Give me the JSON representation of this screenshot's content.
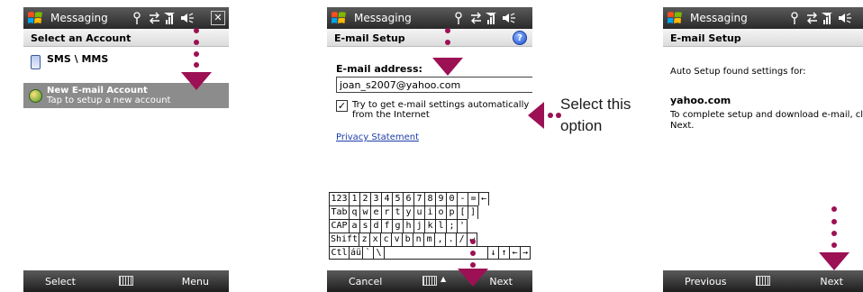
{
  "accent_color": "#9c1054",
  "screens": [
    {
      "title_bar": {
        "app_name": "Messaging",
        "icons": [
          "windows-logo",
          "antenna-icon",
          "data-sync-icon",
          "signal-bars-icon",
          "speaker-icon",
          "close-icon"
        ],
        "close_label": "✕"
      },
      "header": "Select an Account",
      "accounts": [
        {
          "name": "SMS \\ MMS",
          "icon": "sms-icon"
        },
        {
          "name": "New E-mail Account",
          "subtitle": "Tap to setup a new account",
          "icon": "globe-icon",
          "selected": true
        }
      ],
      "softkeys": {
        "left": "Select",
        "right": "Menu"
      }
    },
    {
      "title_bar": {
        "app_name": "Messaging",
        "icons": [
          "windows-logo",
          "antenna-icon",
          "data-sync-icon",
          "signal-bars-icon",
          "speaker-icon"
        ]
      },
      "header": "E-mail Setup",
      "help_label": "?",
      "form": {
        "email_label": "E-mail address:",
        "email_value": "joan_s2007@yahoo.com",
        "auto_settings_label": "Try to get e-mail settings automatically from the Internet",
        "auto_settings_checked": true,
        "checkmark": "✓",
        "privacy_link": "Privacy Statement"
      },
      "keyboard_rows": [
        [
          "123",
          "1",
          "2",
          "3",
          "4",
          "5",
          "6",
          "7",
          "8",
          "9",
          "0",
          "-",
          "=",
          "←"
        ],
        [
          "Tab",
          "q",
          "w",
          "e",
          "r",
          "t",
          "y",
          "u",
          "i",
          "o",
          "p",
          "[",
          "]"
        ],
        [
          "CAP",
          "a",
          "s",
          "d",
          "f",
          "g",
          "h",
          "j",
          "k",
          "l",
          ";",
          "'"
        ],
        [
          "Shift",
          "z",
          "x",
          "c",
          "v",
          "b",
          "n",
          "m",
          ",",
          ".",
          "/",
          "↵"
        ],
        [
          "Ctl",
          "áü",
          "`",
          "\\",
          " ",
          "↓",
          "↑",
          "←",
          "→"
        ]
      ],
      "softkeys": {
        "left": "Cancel",
        "right": "Next"
      }
    },
    {
      "title_bar": {
        "app_name": "Messaging",
        "icons": [
          "windows-logo",
          "antenna-icon",
          "data-sync-icon",
          "signal-bars-icon",
          "speaker-icon"
        ]
      },
      "header": "E-mail Setup",
      "body": {
        "found_text": "Auto Setup found settings for:",
        "domain": "yahoo.com",
        "instruction_line1": "To complete setup and download e-mail, click",
        "instruction_line2": "Next."
      },
      "softkeys": {
        "left": "Previous",
        "right": "Next"
      }
    }
  ],
  "annotation": {
    "line1": "Select this",
    "line2": "option"
  }
}
